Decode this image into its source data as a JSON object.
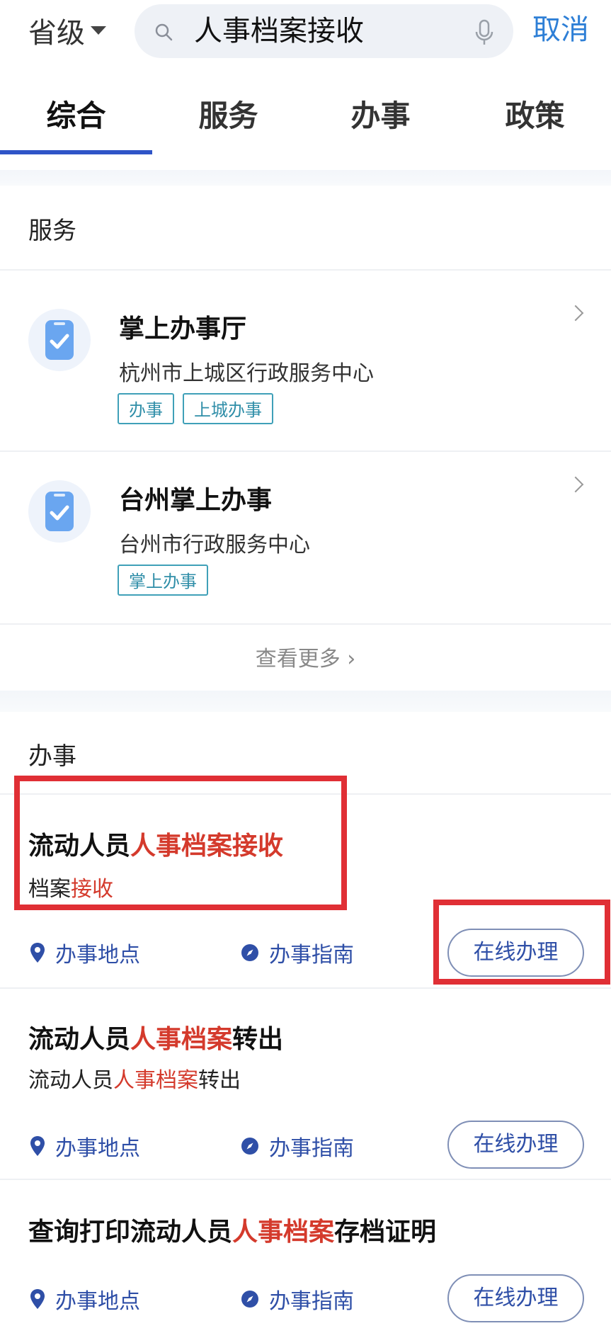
{
  "header": {
    "region_label": "省级",
    "search_value": "人事档案接收",
    "cancel_label": "取消"
  },
  "tabs": [
    {
      "label": "综合",
      "active": true
    },
    {
      "label": "服务",
      "active": false
    },
    {
      "label": "办事",
      "active": false
    },
    {
      "label": "政策",
      "active": false
    }
  ],
  "services_section": {
    "title": "服务",
    "items": [
      {
        "title": "掌上办事厅",
        "subtitle": "杭州市上城区行政服务中心",
        "tags": [
          "办事",
          "上城办事"
        ],
        "icon": "phone-check-icon"
      },
      {
        "title": "台州掌上办事",
        "subtitle": "台州市行政服务中心",
        "tags": [
          "掌上办事"
        ],
        "icon": "phone-check-icon"
      }
    ],
    "more_label": "查看更多 ›"
  },
  "tasks_section": {
    "title": "办事",
    "items": [
      {
        "title_pre": "流动人员",
        "title_hl": "人事档案接收",
        "title_post": "",
        "sub_pre": "档案",
        "sub_hl": "接收",
        "sub_post": "",
        "location_label": "办事地点",
        "guide_label": "办事指南",
        "online_label": "在线办理"
      },
      {
        "title_pre": "流动人员",
        "title_hl": "人事档案",
        "title_post": "转出",
        "sub_pre": "流动人员",
        "sub_hl": "人事档案",
        "sub_post": "转出",
        "location_label": "办事地点",
        "guide_label": "办事指南",
        "online_label": "在线办理"
      },
      {
        "title_pre": "查询打印流动人员",
        "title_hl": "人事档案",
        "title_post": "存档证明",
        "location_label": "办事地点",
        "guide_label": "办事指南",
        "online_label": "在线办理"
      }
    ]
  },
  "colors": {
    "accent": "#2f54c7",
    "highlight": "#d43a2c",
    "annotation_red": "#e02f35",
    "tag": "#2f8ea8",
    "cancel": "#2e7fd6"
  }
}
